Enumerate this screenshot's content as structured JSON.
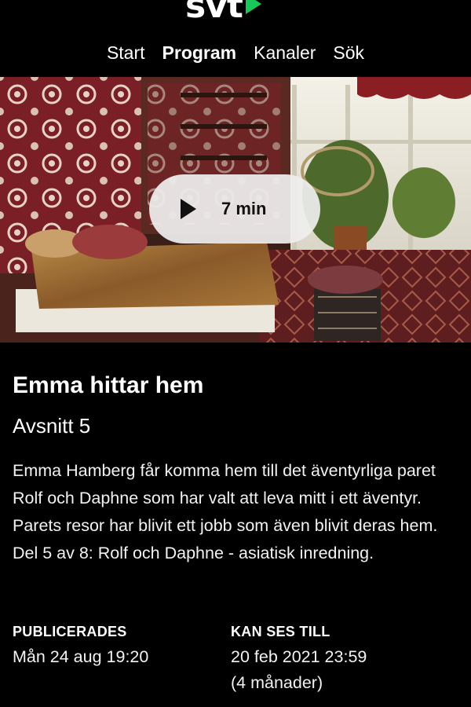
{
  "brand": {
    "logo_text": "svt",
    "accent": "#16c75a"
  },
  "nav": {
    "items": [
      {
        "label": "Start",
        "active": false
      },
      {
        "label": "Program",
        "active": true
      },
      {
        "label": "Kanaler",
        "active": false
      },
      {
        "label": "Sök",
        "active": false
      }
    ]
  },
  "hero": {
    "play_label": "7 min",
    "icon": "play-icon"
  },
  "episode": {
    "title": "Emma hittar hem",
    "subtitle": "Avsnitt 5",
    "description": "Emma Hamberg får komma hem till det äventyrliga paret Rolf och Daphne som har valt att leva mitt i ett äventyr. Parets resor har blivit ett jobb som även blivit deras hem. Del 5 av 8: Rolf och Daphne - asiatisk inredning."
  },
  "meta": {
    "published_label": "PUBLICERADES",
    "published_value": "Mån 24 aug 19:20",
    "available_label": "KAN SES TILL",
    "available_value": "20 feb 2021 23:59",
    "available_note": "(4 månader)"
  }
}
